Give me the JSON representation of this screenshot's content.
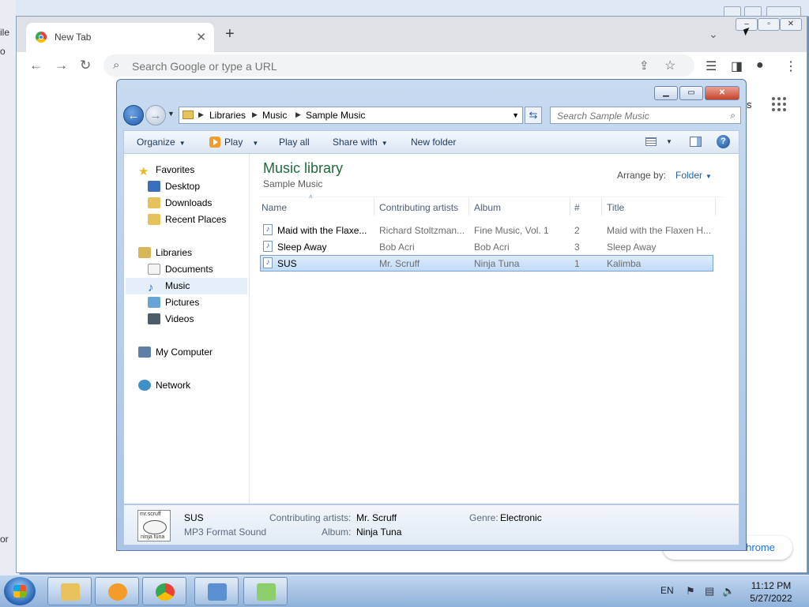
{
  "background_app": {
    "fragments": [
      "ile",
      "o",
      "or"
    ]
  },
  "chrome": {
    "tab_title": "New Tab",
    "tab_close": "✕",
    "new_tab": "+",
    "omnibox_placeholder": "Search Google or type a URL",
    "link_partial": "Chrome",
    "page_fragment": "s"
  },
  "explorer": {
    "breadcrumb": [
      "Libraries",
      "Music",
      "Sample Music"
    ],
    "search_placeholder": "Search Sample Music",
    "commands": {
      "organize": "Organize",
      "play": "Play",
      "play_all": "Play all",
      "share_with": "Share with",
      "new_folder": "New folder"
    },
    "nav": {
      "favorites": "Favorites",
      "desktop": "Desktop",
      "downloads": "Downloads",
      "recent_places": "Recent Places",
      "libraries": "Libraries",
      "documents": "Documents",
      "music": "Music",
      "pictures": "Pictures",
      "videos": "Videos",
      "my_computer": "My Computer",
      "network": "Network"
    },
    "library_title": "Music library",
    "library_subtitle": "Sample Music",
    "arrange_by_label": "Arrange by:",
    "arrange_by_value": "Folder",
    "columns": [
      "Name",
      "Contributing artists",
      "Album",
      "#",
      "Title"
    ],
    "rows": [
      {
        "name": "Maid with the Flaxe...",
        "artists": "Richard Stoltzman...",
        "album": "Fine Music, Vol. 1",
        "num": "2",
        "title": "Maid with the Flaxen H..."
      },
      {
        "name": "Sleep Away",
        "artists": "Bob Acri",
        "album": "Bob Acri",
        "num": "3",
        "title": "Sleep Away"
      },
      {
        "name": "SUS",
        "artists": "Mr. Scruff",
        "album": "Ninja Tuna",
        "num": "1",
        "title": "Kalimba"
      }
    ],
    "details": {
      "album_art_top": "mr.scruff",
      "album_art_bottom": "ninja tuna",
      "file_name": "SUS",
      "file_type": "MP3 Format Sound",
      "artists_label": "Contributing artists:",
      "artists_value": "Mr. Scruff",
      "album_label": "Album:",
      "album_value": "Ninja Tuna",
      "genre_label": "Genre:",
      "genre_value": "Electronic"
    }
  },
  "taskbar": {
    "language": "EN",
    "time": "11:12 PM",
    "date": "5/27/2022"
  },
  "colors": {
    "selection": "#c1dbf8",
    "library_title": "#1e6b3a",
    "link": "#1a73e8"
  }
}
